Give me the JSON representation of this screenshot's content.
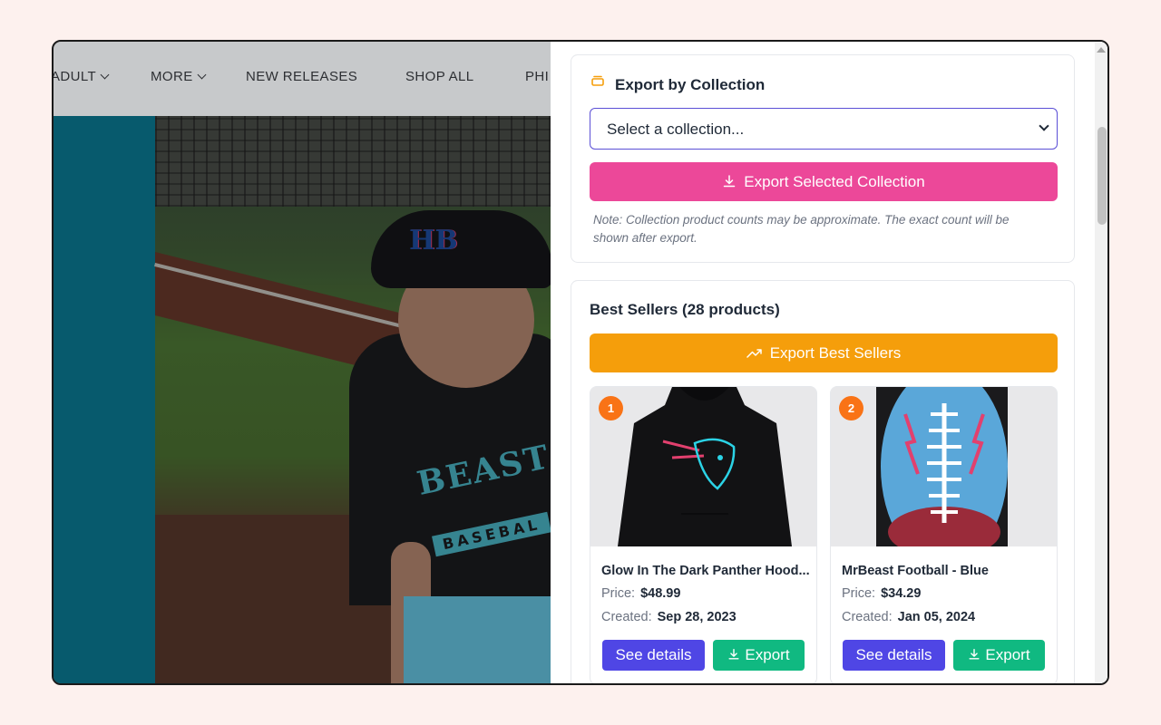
{
  "site": {
    "nav": [
      "ADULT",
      "MORE",
      "NEW RELEASES",
      "SHOP ALL",
      "PHI"
    ],
    "cap_logo": "HB",
    "shirt_text": "BEAST",
    "shirt_subtext": "BASEBAL"
  },
  "collection": {
    "title": "Export by Collection",
    "select_value": "Select a collection...",
    "export_button": "Export Selected Collection",
    "note": "Note: Collection product counts may be approximate. The exact count will be shown after export."
  },
  "best_sellers": {
    "title": "Best Sellers (28 products)",
    "export_button": "Export Best Sellers",
    "price_label": "Price:",
    "created_label": "Created:",
    "details_label": "See details",
    "export_label": "Export",
    "products": [
      {
        "rank": "1",
        "name": "Glow In The Dark Panther Hood...",
        "price": "$48.99",
        "created": "Sep 28, 2023"
      },
      {
        "rank": "2",
        "name": "MrBeast Football - Blue",
        "price": "$34.29",
        "created": "Jan 05, 2024"
      }
    ]
  },
  "colors": {
    "pink": "#ec4899",
    "orange": "#f59e0b",
    "indigo": "#4f46e5",
    "green": "#10b981",
    "badge": "#f97316"
  }
}
